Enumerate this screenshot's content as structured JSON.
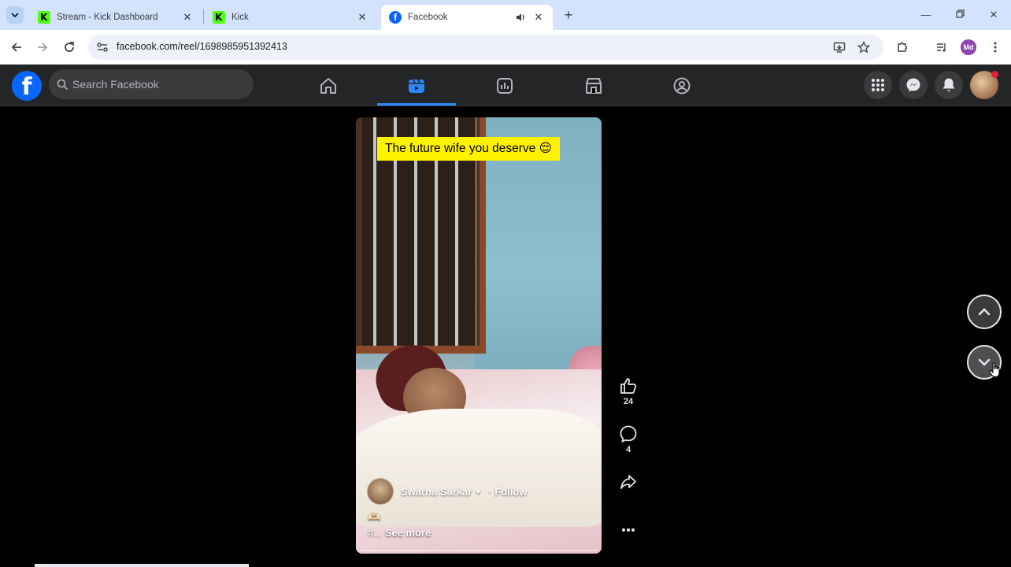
{
  "browser": {
    "tabs": [
      {
        "title": "Stream - Kick Dashboard",
        "favicon": "kick-icon",
        "active": false
      },
      {
        "title": "Kick",
        "favicon": "kick-icon",
        "active": false
      },
      {
        "title": "Facebook",
        "favicon": "facebook-icon",
        "active": true,
        "audio": true
      }
    ],
    "url": "facebook.com/reel/1698985951392413",
    "profile_initials": "Md"
  },
  "facebook": {
    "logo": "f",
    "search_placeholder": "Search Facebook",
    "nav": [
      "home-icon",
      "reels-icon",
      "groups-icon",
      "marketplace-icon",
      "profile-circle-icon"
    ],
    "active_nav": "reels-icon",
    "accent": "#2d88ff",
    "brand": "#0866ff"
  },
  "reel": {
    "caption": "The future wife you deserve 😌",
    "author": "Swarna Sarkar",
    "verified_icon": "verified-icon",
    "follow_label": "· Follow",
    "description_line1": "🫶🏻",
    "description_line2_prefix": "#... ",
    "see_more_label": "See more",
    "likes": "24",
    "comments": "4"
  }
}
